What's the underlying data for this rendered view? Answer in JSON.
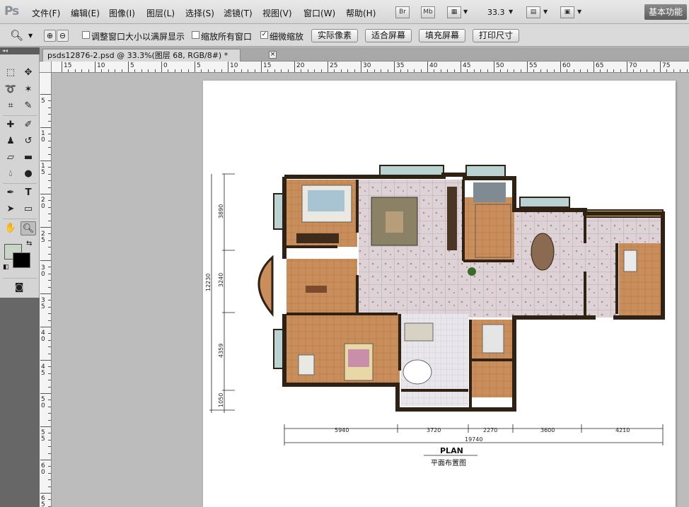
{
  "app": {
    "logo": "Ps",
    "menu": [
      "文件(F)",
      "编辑(E)",
      "图像(I)",
      "图层(L)",
      "选择(S)",
      "滤镜(T)",
      "视图(V)",
      "窗口(W)",
      "帮助(H)"
    ],
    "bridge_label": "Br",
    "minibridge_label": "Mb",
    "zoom": "33.3",
    "workspace": "基本功能"
  },
  "options": {
    "resize_windows": "调整窗口大小以满屏显示",
    "zoom_all": "缩放所有窗口",
    "scrubby_zoom": "细微缩放",
    "actual_pixels": "实际像素",
    "fit_screen": "适合屏幕",
    "fill_screen": "填充屏幕",
    "print_size": "打印尺寸",
    "resize_checked": false,
    "zoom_all_checked": false,
    "scrubby_checked": true
  },
  "document": {
    "tab_title": "psds12876-2.psd @ 33.3%(图层 68, RGB/8#) *",
    "close": "×"
  },
  "rulers": {
    "horizontal": [
      "15",
      "10",
      "5",
      "0",
      "5",
      "10",
      "15",
      "20",
      "25",
      "30",
      "35",
      "40",
      "45",
      "50",
      "55",
      "60",
      "65",
      "70",
      "75"
    ],
    "vertical": [
      "5",
      "10",
      "15",
      "20",
      "25",
      "30",
      "35",
      "40",
      "45",
      "50",
      "55",
      "60",
      "65"
    ]
  },
  "plan": {
    "title": "PLAN",
    "subtitle": "平面布置图",
    "dims_bottom": [
      "5940",
      "3720",
      "2270",
      "3600",
      "4210"
    ],
    "dim_total": "19740",
    "dims_left": [
      "3890",
      "3240",
      "4359",
      "1050"
    ],
    "dim_left_total": "12230"
  },
  "colors": {
    "wall": "#2f2113",
    "wood_floor": "#c98e5c",
    "tile_floor": "#ddd2d6",
    "tile_accent": "#b4898e",
    "canvas_bg": "#bcbcbc",
    "panel_bg": "#d4d4d4"
  }
}
